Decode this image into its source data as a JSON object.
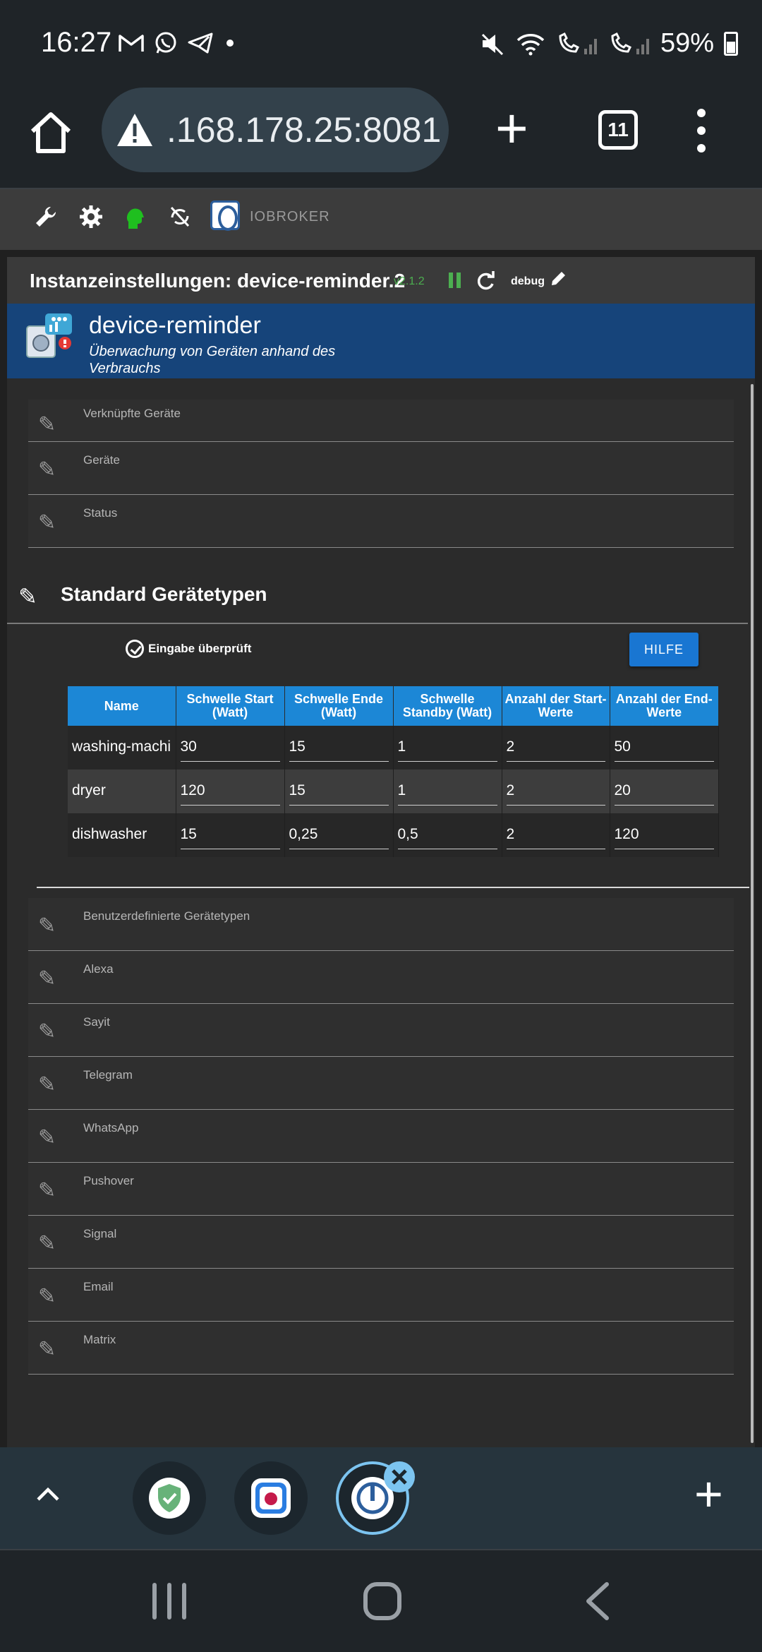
{
  "status_bar": {
    "time": "16:27",
    "battery": "59%",
    "left_icons": [
      "gmail-icon",
      "whatsapp-icon",
      "telegram-icon",
      "dot-icon"
    ],
    "right_icons": [
      "mute-icon",
      "wifi-icon",
      "sim1-call-icon",
      "sim2-call-icon",
      "battery-icon"
    ]
  },
  "browser": {
    "url": ".168.178.25:8081",
    "tab_count": "11"
  },
  "iobroker": {
    "brand": "IOBROKER",
    "toolbar_icons": [
      "wrench-icon",
      "gear-icon",
      "user-icon",
      "sync-off-icon"
    ]
  },
  "panel": {
    "title": "Instanzeinstellungen: device-reminder.2",
    "version": "v2.1.2",
    "log_level": "debug",
    "adapter_name": "device-reminder",
    "adapter_desc": "Überwachung von Geräten anhand des Verbrauchs",
    "top_rows": [
      "Verknüpfte Geräte",
      "Geräte",
      "Status"
    ],
    "section_title": "Standard Gerätetypen",
    "checked_label": "Eingabe überprüft",
    "help_button": "HILFE",
    "table": {
      "headers": [
        "Name",
        "Schwelle Start (Watt)",
        "Schwelle Ende (Watt)",
        "Schwelle Standby (Watt)",
        "Anzahl der Start-Werte",
        "Anzahl der End-Werte"
      ],
      "rows": [
        [
          "washing-machine",
          "30",
          "15",
          "1",
          "2",
          "50"
        ],
        [
          "dryer",
          "120",
          "15",
          "1",
          "2",
          "20"
        ],
        [
          "dishwasher",
          "15",
          "0,25",
          "0,5",
          "2",
          "120"
        ]
      ]
    },
    "bottom_rows": [
      "Benutzerdefinierte Gerätetypen",
      "Alexa",
      "Sayit",
      "Telegram",
      "WhatsApp",
      "Pushover",
      "Signal",
      "Email",
      "Matrix"
    ]
  },
  "colors": {
    "banner": "#16447a",
    "table_header": "#1c87d6",
    "accent_green": "#4caf50",
    "button_blue": "#1976d2"
  }
}
